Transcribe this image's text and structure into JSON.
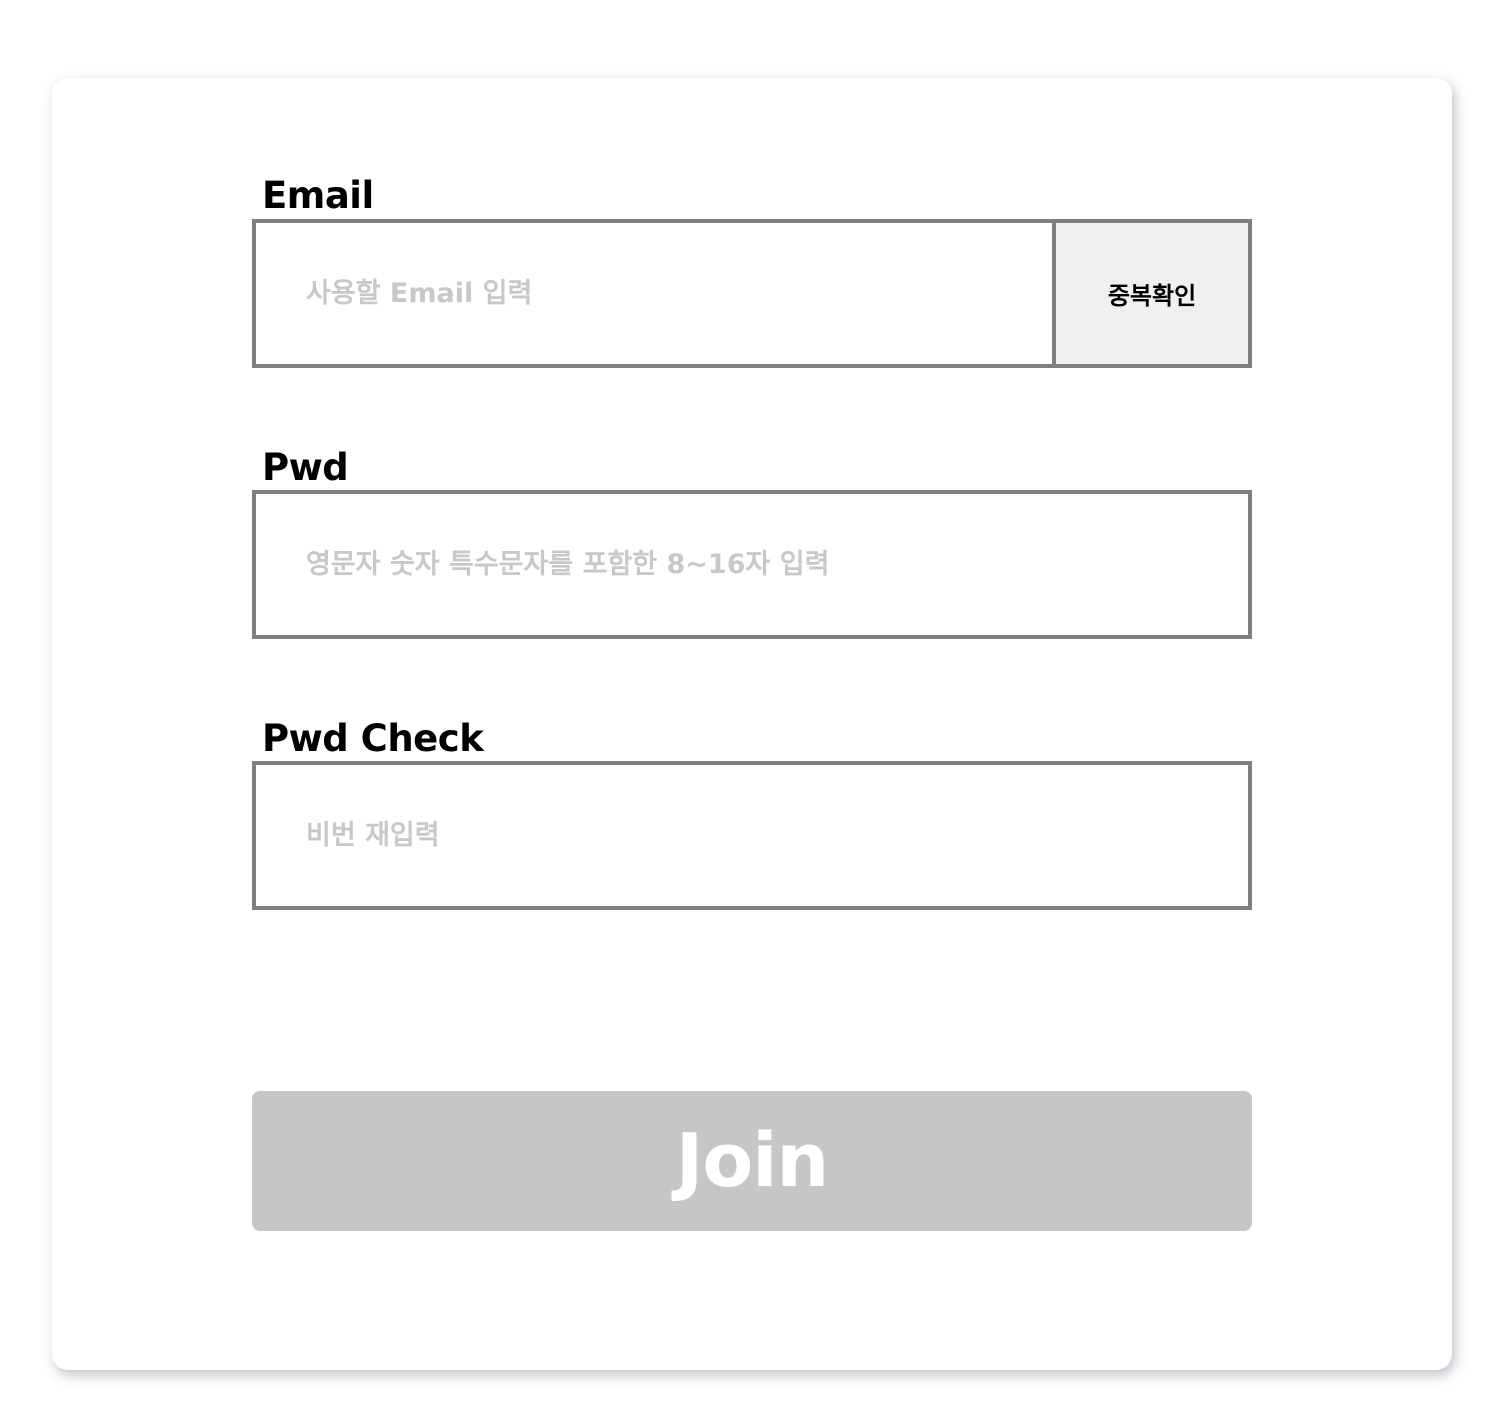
{
  "form": {
    "email": {
      "label": "Email",
      "placeholder": "사용할 Email 입력",
      "value": "",
      "check_button_label": "중복확인"
    },
    "password": {
      "label": "Pwd",
      "placeholder": "영문자 숫자 특수문자를 포함한 8~16자 입력",
      "value": ""
    },
    "password_check": {
      "label": "Pwd Check",
      "placeholder": "비번 재입력",
      "value": ""
    },
    "submit_label": "Join"
  },
  "colors": {
    "field_border": "#808080",
    "placeholder_text": "#c8c8c8",
    "check_button_bg": "#f0f0f0",
    "join_button_bg": "#c6c6c6",
    "join_button_text": "#ffffff"
  }
}
